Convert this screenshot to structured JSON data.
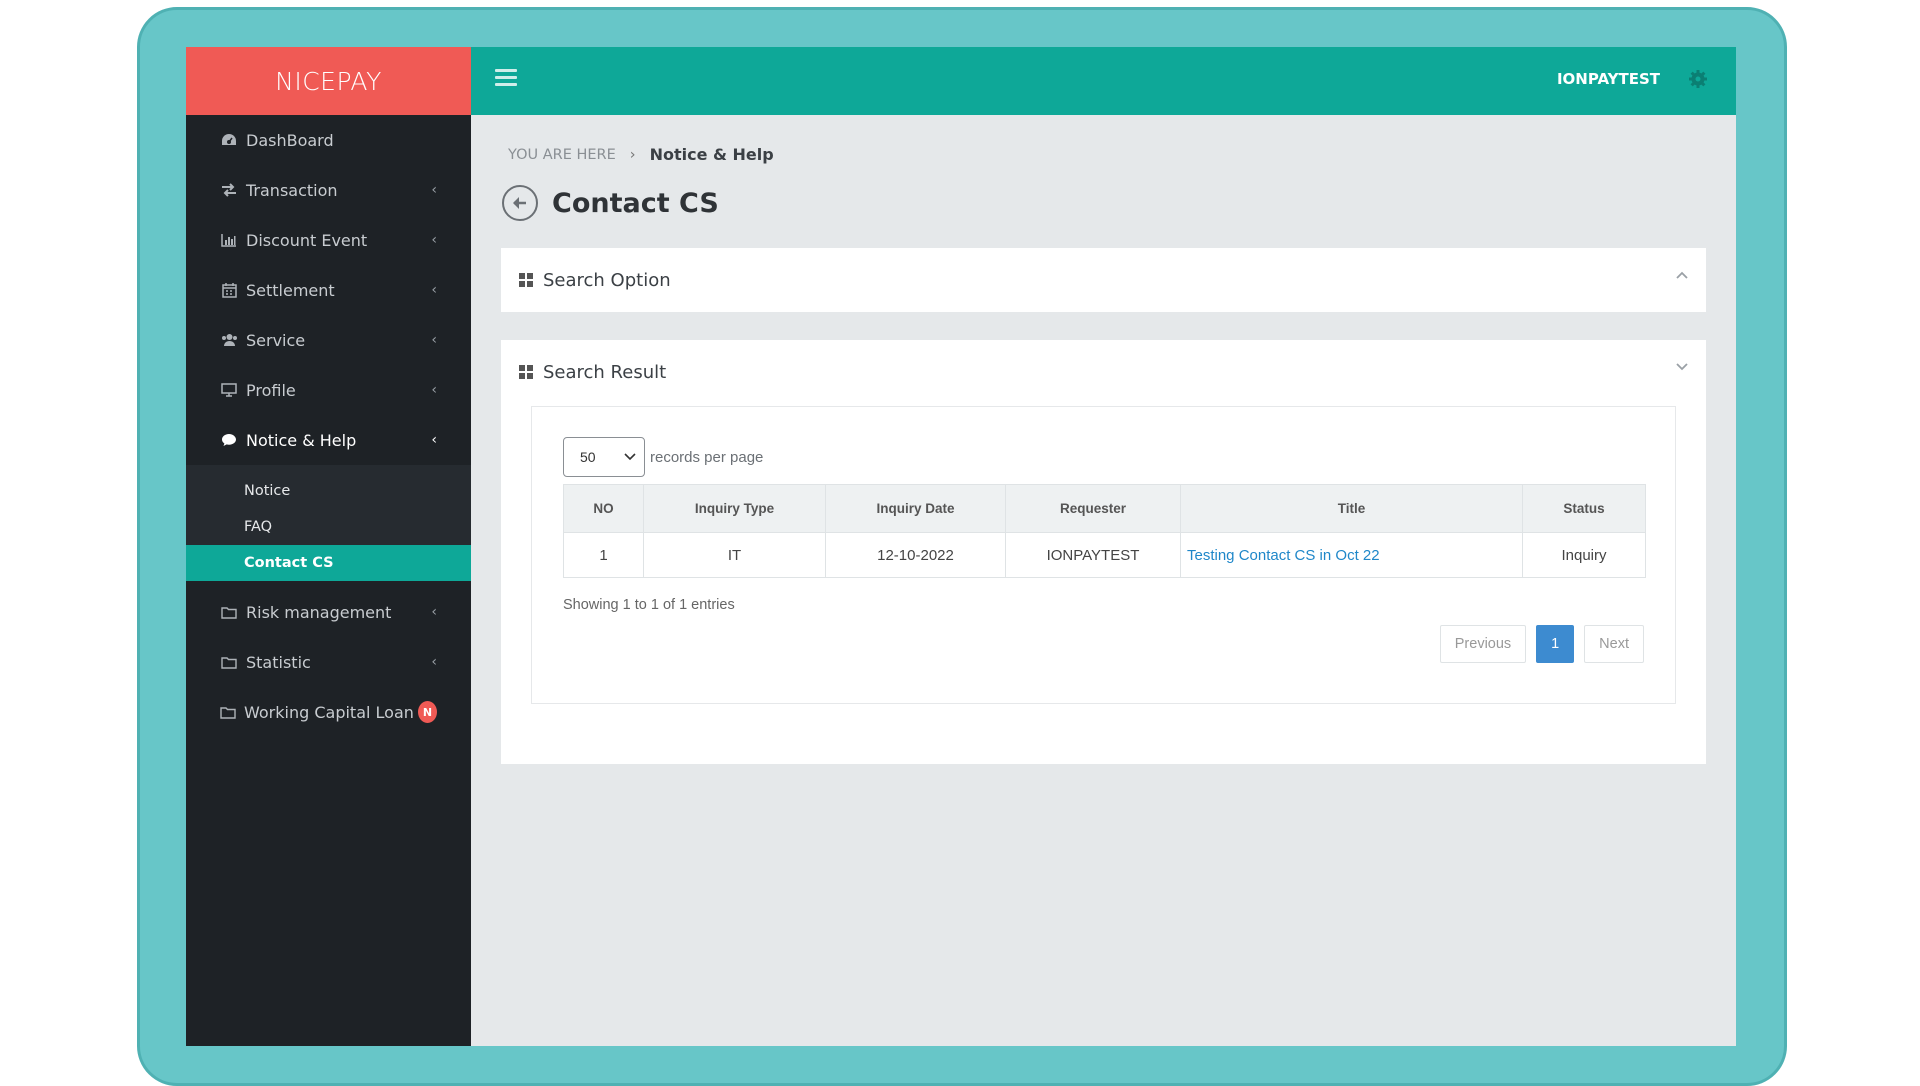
{
  "brand": "NICEPAY",
  "topbar": {
    "username": "IONPAYTEST"
  },
  "sidebar": {
    "items": [
      {
        "label": "DashBoard",
        "icon": "dashboard-icon"
      },
      {
        "label": "Transaction",
        "icon": "exchange-icon"
      },
      {
        "label": "Discount Event",
        "icon": "bar-chart-icon"
      },
      {
        "label": "Settlement",
        "icon": "calendar-icon"
      },
      {
        "label": "Service",
        "icon": "users-icon"
      },
      {
        "label": "Profile",
        "icon": "desktop-icon"
      },
      {
        "label": "Notice & Help",
        "icon": "comment-icon"
      },
      {
        "label": "Risk management",
        "icon": "folder-icon"
      },
      {
        "label": "Statistic",
        "icon": "folder-icon"
      },
      {
        "label": "Working Capital Loan",
        "icon": "folder-icon",
        "badge": "N"
      }
    ],
    "submenu": [
      {
        "label": "Notice"
      },
      {
        "label": "FAQ"
      },
      {
        "label": "Contact CS"
      }
    ]
  },
  "breadcrumb": {
    "prefix": "YOU ARE HERE",
    "separator": "›",
    "current": "Notice & Help"
  },
  "page_title": "Contact CS",
  "search_option": {
    "title": "Search Option"
  },
  "search_result": {
    "title": "Search Result",
    "per_page_value": "50",
    "per_page_label": "records per page",
    "columns": [
      "NO",
      "Inquiry Type",
      "Inquiry Date",
      "Requester",
      "Title",
      "Status"
    ],
    "rows": [
      [
        "1",
        "IT",
        "12-10-2022",
        "IONPAYTEST",
        "Testing Contact CS in Oct 22",
        "Inquiry"
      ]
    ],
    "showing": "Showing 1 to 1 of 1 entries",
    "pagination": {
      "previous": "Previous",
      "current": "1",
      "next": "Next"
    }
  },
  "colors": {
    "teal": "#0ea898",
    "brand_red": "#f05a55",
    "sidebar_bg": "#1e2226",
    "link": "#1f87c9",
    "page_active": "#3d8bd0"
  }
}
